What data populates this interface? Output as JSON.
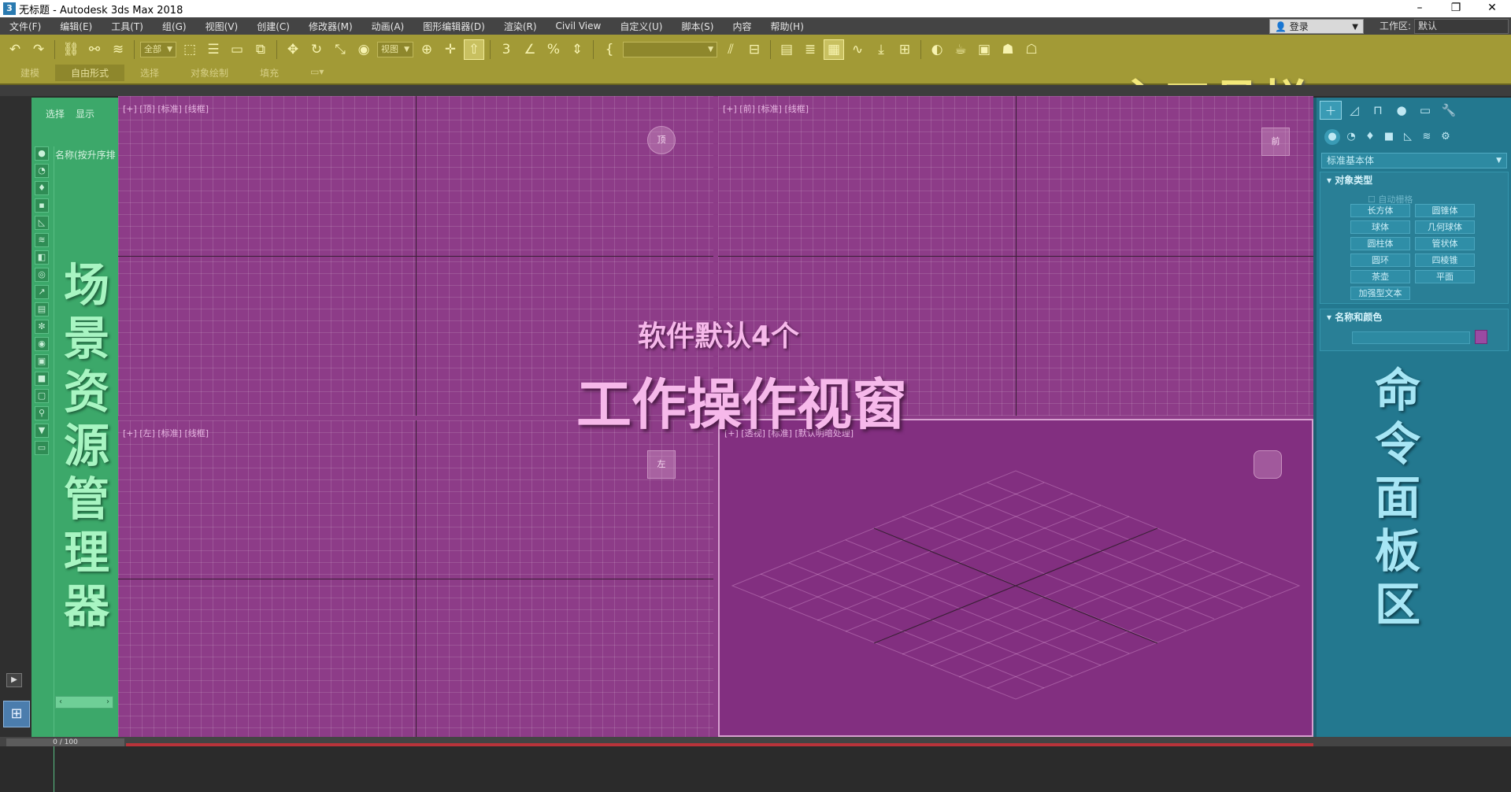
{
  "window": {
    "title": "无标题 - Autodesk 3ds Max 2018",
    "app_icon": "3",
    "controls": [
      "–",
      "❐",
      "✕"
    ]
  },
  "menu": {
    "items": [
      "文件(F)",
      "编辑(E)",
      "工具(T)",
      "组(G)",
      "视图(V)",
      "创建(C)",
      "修改器(M)",
      "动画(A)",
      "图形编辑器(D)",
      "渲染(R)",
      "Civil View",
      "自定义(U)",
      "脚本(S)",
      "内容",
      "帮助(H)"
    ],
    "login": "登录",
    "workspace_label": "工作区:",
    "workspace_value": "默认"
  },
  "toolbar": {
    "selection_filter": "全部",
    "reference_coord": "视图",
    "named_selection": "",
    "ribbon_tabs": [
      "建模",
      "自由形式",
      "选择",
      "对象绘制",
      "填充"
    ],
    "overlay_label": "主工具栏",
    "icons": [
      "undo-icon",
      "redo-icon",
      "link-icon",
      "unlink-icon",
      "bind-spacewarp-icon",
      "select-object-icon",
      "select-by-name-icon",
      "rect-region-icon",
      "window-crossing-icon",
      "move-icon",
      "rotate-icon",
      "scale-icon",
      "placement-icon",
      "pivot-icon",
      "manipulate-icon",
      "snap-icon",
      "angle-snap-icon",
      "percent-snap-icon",
      "spinner-snap-icon",
      "edit-named-sel-icon",
      "mirror-icon",
      "align-icon",
      "layer-explorer-icon",
      "ribbon-icon",
      "curve-editor-icon",
      "schematic-icon",
      "material-editor-icon",
      "render-setup-icon",
      "render-frame-icon",
      "render-icon"
    ]
  },
  "scene_explorer": {
    "tabs": [
      "选择",
      "显示"
    ],
    "column_header": "名称(按升序排",
    "overlay_label": [
      "场",
      "景",
      "资",
      "源",
      "管",
      "理",
      "器"
    ]
  },
  "viewports": {
    "top": {
      "label": "[+] [顶] [标准] [线框]",
      "cube": "顶"
    },
    "front": {
      "label": "[+] [前] [标准] [线框]",
      "cube": "前"
    },
    "left": {
      "label": "[+] [左] [标准] [线框]",
      "cube": "左"
    },
    "perspective": {
      "label": "[+] [透视] [标准] [默认明暗处理]",
      "cube": ""
    },
    "overlay_sub": "软件默认4个",
    "overlay_main": "工作操作视窗"
  },
  "command_panel": {
    "category": "标准基本体",
    "object_type_title": "对象类型",
    "auto_grid": "自动栅格",
    "primitives": [
      "长方体",
      "圆锥体",
      "球体",
      "几何球体",
      "圆柱体",
      "管状体",
      "圆环",
      "四棱锥",
      "茶壶",
      "平面",
      "加强型文本"
    ],
    "name_color_title": "名称和颜色",
    "object_color": "#9a4aa2",
    "overlay_label": [
      "命",
      "令",
      "面",
      "板",
      "区"
    ]
  },
  "timeline": {
    "frame": "0 / 100"
  }
}
